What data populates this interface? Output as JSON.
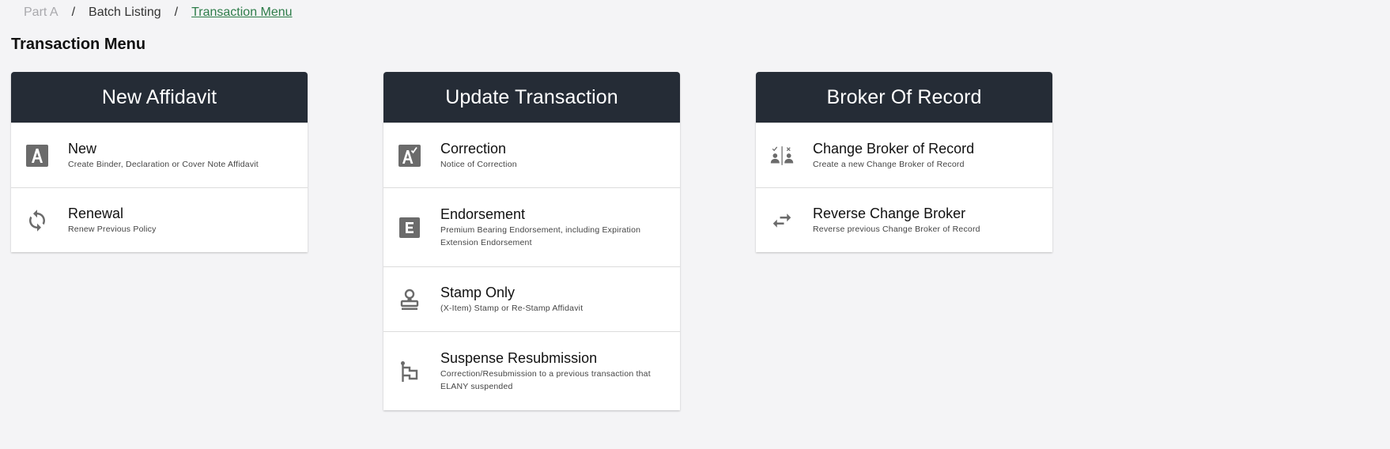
{
  "breadcrumb": {
    "items": [
      "Part A",
      "Batch Listing",
      "Transaction Menu"
    ],
    "separator": "/"
  },
  "page": {
    "title": "Transaction Menu"
  },
  "cards": [
    {
      "title": "New Affidavit",
      "items": [
        {
          "title": "New",
          "desc": "Create Binder, Declaration or Cover Note Affidavit",
          "icon": "letter-a-box-icon"
        },
        {
          "title": "Renewal",
          "desc": "Renew Previous Policy",
          "icon": "refresh-icon"
        }
      ]
    },
    {
      "title": "Update Transaction",
      "items": [
        {
          "title": "Correction",
          "desc": "Notice of Correction",
          "icon": "letter-a-check-icon"
        },
        {
          "title": "Endorsement",
          "desc": "Premium Bearing Endorsement, including Expiration Extension Endorsement",
          "icon": "letter-e-box-icon"
        },
        {
          "title": "Stamp Only",
          "desc": "(X-Item) Stamp or Re-Stamp Affidavit",
          "icon": "stamp-icon"
        },
        {
          "title": "Suspense Resubmission",
          "desc": "Correction/Resubmission to a previous transaction that ELANY suspended",
          "icon": "flag-icon"
        }
      ]
    },
    {
      "title": "Broker Of Record",
      "items": [
        {
          "title": "Change Broker of Record",
          "desc": "Create a new Change Broker of Record",
          "icon": "account-switch-icon"
        },
        {
          "title": "Reverse Change Broker",
          "desc": "Reverse previous Change Broker of Record",
          "icon": "swap-arrows-icon"
        }
      ]
    }
  ],
  "colors": {
    "header_bg": "#252c36",
    "icon": "#6b6b6b",
    "link_active": "#2e7d4a",
    "page_bg": "#f4f4f6"
  }
}
